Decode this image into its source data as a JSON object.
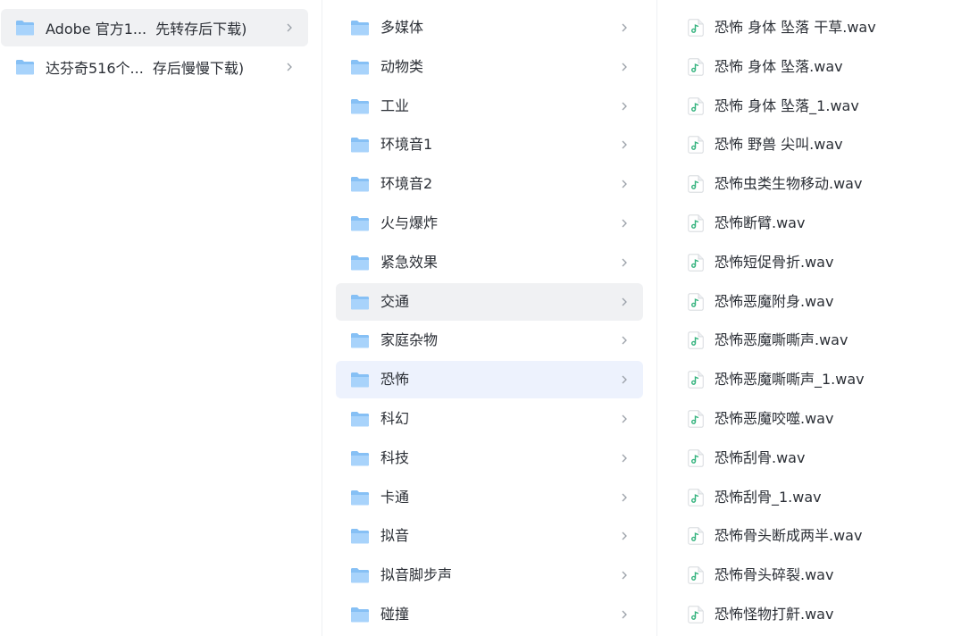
{
  "columns": {
    "root": {
      "items": [
        {
          "part1": "Adobe 官方1...",
          "part2": "先转存后下载)"
        },
        {
          "part1": "达芬奇516个...",
          "part2": "存后慢慢下载)"
        }
      ]
    },
    "folders": {
      "items": [
        {
          "label": "多媒体"
        },
        {
          "label": "动物类"
        },
        {
          "label": "工业"
        },
        {
          "label": "环境音1"
        },
        {
          "label": "环境音2"
        },
        {
          "label": "火与爆炸"
        },
        {
          "label": "紧急效果"
        },
        {
          "label": "交通"
        },
        {
          "label": "家庭杂物"
        },
        {
          "label": "恐怖"
        },
        {
          "label": "科幻"
        },
        {
          "label": "科技"
        },
        {
          "label": "卡通"
        },
        {
          "label": "拟音"
        },
        {
          "label": "拟音脚步声"
        },
        {
          "label": "碰撞"
        }
      ]
    },
    "files": {
      "items": [
        {
          "label": "恐怖 身体 坠落 干草.wav"
        },
        {
          "label": "恐怖 身体 坠落.wav"
        },
        {
          "label": "恐怖 身体 坠落_1.wav"
        },
        {
          "label": "恐怖 野兽 尖叫.wav"
        },
        {
          "label": "恐怖虫类生物移动.wav"
        },
        {
          "label": "恐怖断臂.wav"
        },
        {
          "label": "恐怖短促骨折.wav"
        },
        {
          "label": "恐怖恶魔附身.wav"
        },
        {
          "label": "恐怖恶魔嘶嘶声.wav"
        },
        {
          "label": "恐怖恶魔嘶嘶声_1.wav"
        },
        {
          "label": "恐怖恶魔咬噬.wav"
        },
        {
          "label": "恐怖刮骨.wav"
        },
        {
          "label": "恐怖刮骨_1.wav"
        },
        {
          "label": "恐怖骨头断成两半.wav"
        },
        {
          "label": "恐怖骨头碎裂.wav"
        },
        {
          "label": "恐怖怪物打鼾.wav"
        }
      ]
    }
  },
  "state": {
    "root_selected_index": 0,
    "folder_hover_index": 7,
    "folder_selected_index": 9
  },
  "colors": {
    "folder_icon": "#86c0f5",
    "audio_icon": "#35b37e",
    "hover_bg": "#f0f1f3",
    "selected_bg": "#edf2fd",
    "chevron": "#9aa0a8"
  },
  "icons": {
    "folder": "folder-icon",
    "audio_file": "audio-file-icon",
    "expand": "chevron-right-icon"
  }
}
